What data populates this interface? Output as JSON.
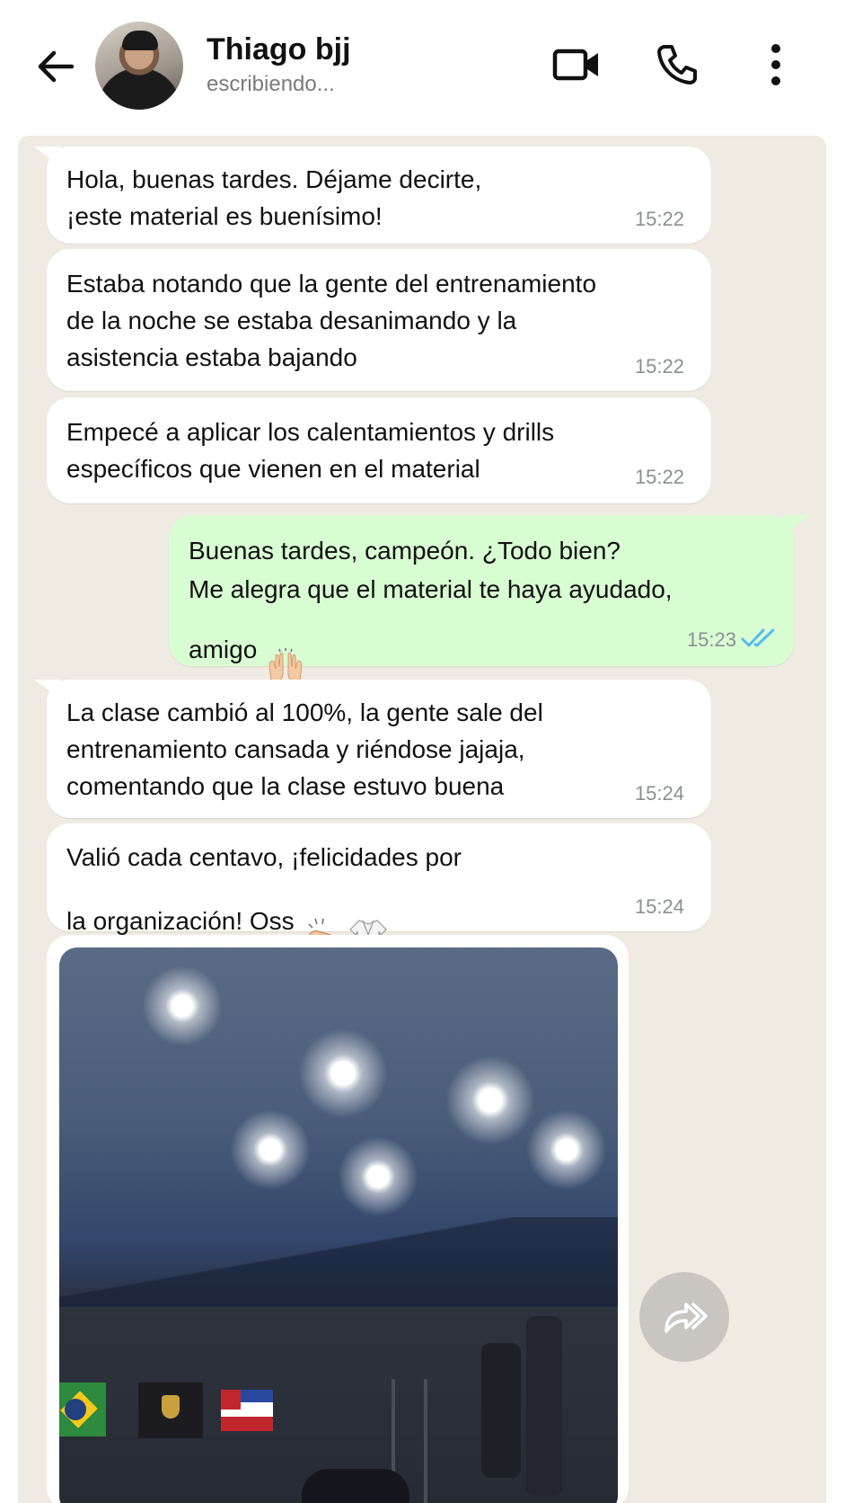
{
  "header": {
    "contact_name": "Thiago bjj",
    "status": "escribiendo...",
    "icons": [
      "back-arrow-icon",
      "video-call-icon",
      "phone-icon",
      "more-options-icon"
    ]
  },
  "messages": [
    {
      "direction": "in",
      "text": "Hola, buenas tardes. Déjame decirte,\n¡este material es buenísimo!",
      "time": "15:22"
    },
    {
      "direction": "in",
      "text": "Estaba notando que la gente del entrenamiento\nde la noche se estaba desanimando y la\nasistencia estaba bajando",
      "time": "15:22"
    },
    {
      "direction": "in",
      "text": "Empecé a aplicar los calentamientos y drills\nespecíficos que vienen en el material",
      "time": "15:22"
    },
    {
      "direction": "out",
      "text": "Buenas tardes, campeón. ¿Todo bien?\nMe alegra que el material te haya ayudado,\namigo",
      "time": "15:23",
      "read_status": "read"
    },
    {
      "direction": "in",
      "text": "La clase cambió al 100%, la gente sale del\nentrenamiento cansada y riéndose jajaja,\ncomentando que la clase estuvo buena",
      "time": "15:24"
    },
    {
      "direction": "in",
      "text": "Valió cada centavo, ¡felicidades por\nla organización! Oss",
      "time": "15:24"
    }
  ],
  "colors": {
    "chat_background": "#efeae2",
    "incoming_bubble": "#ffffff",
    "outgoing_bubble": "#d9fdd3",
    "read_ticks": "#53bdeb",
    "timestamp": "#8a8f92"
  }
}
